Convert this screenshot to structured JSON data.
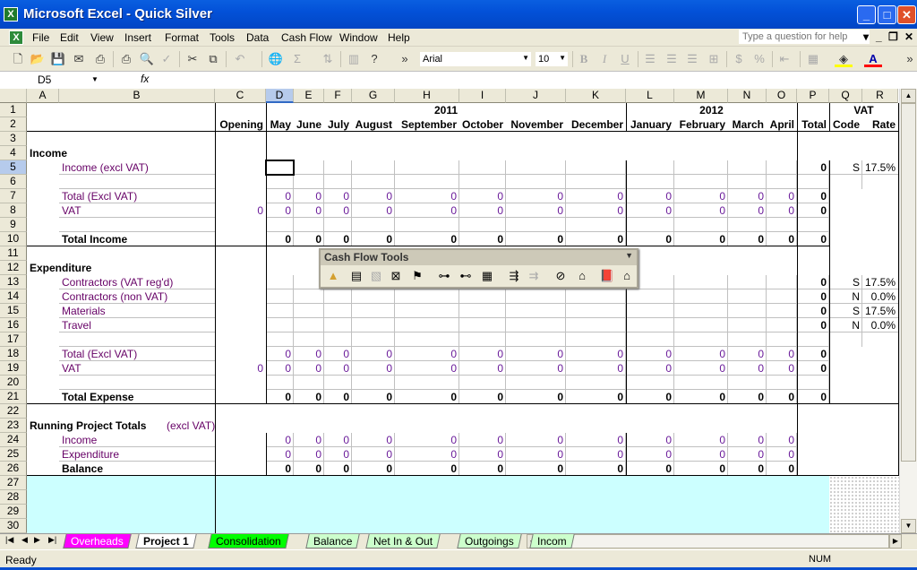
{
  "window": {
    "title": "Microsoft Excel - Quick Silver",
    "app_icon": "excel-icon"
  },
  "menu": [
    "File",
    "Edit",
    "View",
    "Insert",
    "Format",
    "Tools",
    "Data",
    "Cash Flow",
    "Window",
    "Help"
  ],
  "help_placeholder": "Type a question for help",
  "toolbar": {
    "font": "Arial",
    "size": "10"
  },
  "formula_bar": {
    "name_box": "D5",
    "fx": "fx",
    "content": ""
  },
  "columns": [
    "A",
    "B",
    "C",
    "D",
    "E",
    "F",
    "G",
    "H",
    "I",
    "J",
    "K",
    "L",
    "M",
    "N",
    "O",
    "P",
    "Q",
    "R"
  ],
  "selected_cell": {
    "col": "D",
    "row": 5
  },
  "header_groups": {
    "year1": "2011",
    "year2": "2012",
    "vat": "VAT"
  },
  "rows": [
    {
      "n": "1"
    },
    {
      "n": "2",
      "kind": "hdr",
      "cells": {
        "C": "Opening",
        "D": "May",
        "E": "June",
        "F": "July",
        "G": "August",
        "H": "September",
        "I": "October",
        "J": "November",
        "K": "December",
        "L": "January",
        "M": "February",
        "N": "March",
        "O": "April",
        "P": "Total",
        "Q": "Code",
        "R": "Rate"
      }
    },
    {
      "n": "3"
    },
    {
      "n": "4",
      "kind": "section",
      "cells": {
        "A": "Income"
      }
    },
    {
      "n": "5",
      "kind": "input",
      "cells": {
        "B": "Income (excl VAT)",
        "P": "0",
        "Q": "S",
        "R": "17.5%"
      }
    },
    {
      "n": "6",
      "kind": "blank"
    },
    {
      "n": "7",
      "kind": "calc",
      "cells": {
        "B": "Total (Excl VAT)",
        "D": "0",
        "E": "0",
        "F": "0",
        "G": "0",
        "H": "0",
        "I": "0",
        "J": "0",
        "K": "0",
        "L": "0",
        "M": "0",
        "N": "0",
        "O": "0",
        "P": "0"
      }
    },
    {
      "n": "8",
      "kind": "calc",
      "cells": {
        "B": "VAT",
        "C": "0",
        "D": "0",
        "E": "0",
        "F": "0",
        "G": "0",
        "H": "0",
        "I": "0",
        "J": "0",
        "K": "0",
        "L": "0",
        "M": "0",
        "N": "0",
        "O": "0",
        "P": "0"
      }
    },
    {
      "n": "9",
      "kind": "blank"
    },
    {
      "n": "10",
      "kind": "total",
      "cells": {
        "B": "Total Income",
        "D": "0",
        "E": "0",
        "F": "0",
        "G": "0",
        "H": "0",
        "I": "0",
        "J": "0",
        "K": "0",
        "L": "0",
        "M": "0",
        "N": "0",
        "O": "0",
        "P": "0"
      }
    },
    {
      "n": "11"
    },
    {
      "n": "12",
      "kind": "section",
      "cells": {
        "A": "Expenditure"
      }
    },
    {
      "n": "13",
      "kind": "input",
      "cells": {
        "B": "Contractors (VAT reg'd)",
        "P": "0",
        "Q": "S",
        "R": "17.5%"
      }
    },
    {
      "n": "14",
      "kind": "input",
      "cells": {
        "B": "Contractors (non VAT)",
        "P": "0",
        "Q": "N",
        "R": "0.0%"
      }
    },
    {
      "n": "15",
      "kind": "input",
      "cells": {
        "B": "Materials",
        "P": "0",
        "Q": "S",
        "R": "17.5%"
      }
    },
    {
      "n": "16",
      "kind": "input",
      "cells": {
        "B": "Travel",
        "P": "0",
        "Q": "N",
        "R": "0.0%"
      }
    },
    {
      "n": "17",
      "kind": "blank"
    },
    {
      "n": "18",
      "kind": "calc",
      "cells": {
        "B": "Total (Excl VAT)",
        "D": "0",
        "E": "0",
        "F": "0",
        "G": "0",
        "H": "0",
        "I": "0",
        "J": "0",
        "K": "0",
        "L": "0",
        "M": "0",
        "N": "0",
        "O": "0",
        "P": "0"
      }
    },
    {
      "n": "19",
      "kind": "calc",
      "cells": {
        "B": "VAT",
        "C": "0",
        "D": "0",
        "E": "0",
        "F": "0",
        "G": "0",
        "H": "0",
        "I": "0",
        "J": "0",
        "K": "0",
        "L": "0",
        "M": "0",
        "N": "0",
        "O": "0",
        "P": "0"
      }
    },
    {
      "n": "20",
      "kind": "blank"
    },
    {
      "n": "21",
      "kind": "total",
      "cells": {
        "B": "Total Expense",
        "D": "0",
        "E": "0",
        "F": "0",
        "G": "0",
        "H": "0",
        "I": "0",
        "J": "0",
        "K": "0",
        "L": "0",
        "M": "0",
        "N": "0",
        "O": "0",
        "P": "0"
      }
    },
    {
      "n": "22"
    },
    {
      "n": "23",
      "kind": "section",
      "cells": {
        "A": "Running Project Totals",
        "A2": "(excl VAT)"
      }
    },
    {
      "n": "24",
      "kind": "calc",
      "cells": {
        "B": "Income",
        "D": "0",
        "E": "0",
        "F": "0",
        "G": "0",
        "H": "0",
        "I": "0",
        "J": "0",
        "K": "0",
        "L": "0",
        "M": "0",
        "N": "0",
        "O": "0"
      }
    },
    {
      "n": "25",
      "kind": "calc",
      "cells": {
        "B": "Expenditure",
        "D": "0",
        "E": "0",
        "F": "0",
        "G": "0",
        "H": "0",
        "I": "0",
        "J": "0",
        "K": "0",
        "L": "0",
        "M": "0",
        "N": "0",
        "O": "0"
      }
    },
    {
      "n": "26",
      "kind": "total",
      "cells": {
        "B": "Balance",
        "D": "0",
        "E": "0",
        "F": "0",
        "G": "0",
        "H": "0",
        "I": "0",
        "J": "0",
        "K": "0",
        "L": "0",
        "M": "0",
        "N": "0",
        "O": "0"
      }
    },
    {
      "n": "27",
      "kind": "empty"
    },
    {
      "n": "28",
      "kind": "empty"
    },
    {
      "n": "29",
      "kind": "empty"
    },
    {
      "n": "30",
      "kind": "empty"
    }
  ],
  "floating_toolbar": {
    "title": "Cash Flow Tools",
    "icons": [
      "pyramid-icon",
      "sheet-icon",
      "sheet-copy-icon",
      "delete-sheet-icon",
      "sign-icon",
      "link-left-icon",
      "link-right-icon",
      "calendar-icon",
      "import-icon",
      "export-icon",
      "clear-icon",
      "factory-icon",
      "help-book-icon",
      "home-icon"
    ]
  },
  "sheet_tabs": [
    {
      "label": "Overheads",
      "color": "#ff00ff",
      "text": "#ffffff"
    },
    {
      "label": "Project 1",
      "color": "#ffffff",
      "text": "#000000",
      "active": true
    },
    {
      "label": "Consolidation",
      "color": "#00ff00",
      "text": "#000000"
    },
    {
      "label": "Balance",
      "color": "#ccffcc",
      "text": "#000000"
    },
    {
      "label": "Net In & Out",
      "color": "#ccffcc",
      "text": "#000000"
    },
    {
      "label": "Outgoings",
      "color": "#ccffcc",
      "text": "#000000"
    },
    {
      "label": "Incom",
      "color": "#ccffcc",
      "text": "#000000"
    }
  ],
  "status": {
    "left": "Ready",
    "num": "NUM"
  },
  "colors": {
    "empty_area": "#ccffff",
    "label_purple": "#660066"
  }
}
